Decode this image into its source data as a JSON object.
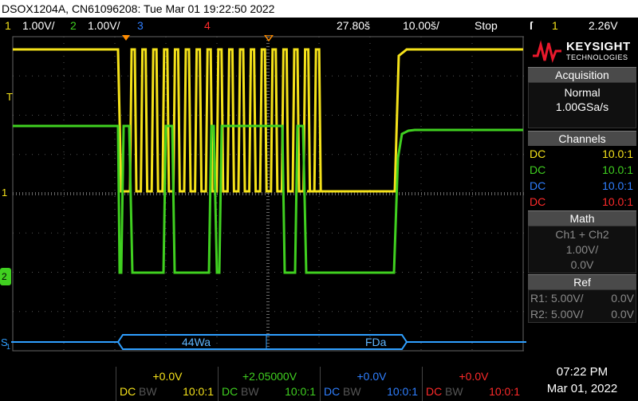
{
  "title_bar": "DSOX1204A, CN61096208: Tue Mar 01 19:22:50 2022",
  "status": {
    "ch1_num": "1",
    "ch1_scale": "1.00V/",
    "ch2_num": "2",
    "ch2_scale": "1.00V/",
    "ch3_num": "3",
    "ch4_num": "4",
    "time_pos": "27.80š",
    "time_scale": "10.00š/",
    "run_state": "Stop",
    "trig_icon": "ſ",
    "trig_ch": "1",
    "trig_level": "2.26V"
  },
  "logo": {
    "brand": "KEYSIGHT",
    "sub": "TECHNOLOGIES"
  },
  "acquisition": {
    "header": "Acquisition",
    "mode": "Normal",
    "rate": "1.00GSa/s"
  },
  "channels": {
    "header": "Channels",
    "rows": [
      {
        "coupling": "DC",
        "ratio": "10.0:1",
        "color": "#f5e21a"
      },
      {
        "coupling": "DC",
        "ratio": "10.0:1",
        "color": "#40d020"
      },
      {
        "coupling": "DC",
        "ratio": "10.0:1",
        "color": "#2f7fff"
      },
      {
        "coupling": "DC",
        "ratio": "10.0:1",
        "color": "#ff2a2a"
      }
    ]
  },
  "math": {
    "header": "Math",
    "function": "Ch1 + Ch2",
    "scale": "1.00V/",
    "offset": "0.0V"
  },
  "ref": {
    "header": "Ref",
    "r1_label": "R1:",
    "r1_scale": "5.00V/",
    "r1_offset": "0.0V",
    "r2_label": "R2:",
    "r2_scale": "5.00V/",
    "r2_offset": "0.0V"
  },
  "markers": {
    "t_marker": "T",
    "ch1_ground": "1",
    "ch2_ground": "2",
    "serial_label": "S",
    "serial_sub": "1"
  },
  "serial_decode": {
    "packet1": "44Wa",
    "packet2": "FDa"
  },
  "bottom_channels": [
    {
      "offset": "+0.0V",
      "coupling": "DC",
      "bw": "BW",
      "ratio": "10:0:1",
      "color": "#f5e21a"
    },
    {
      "offset": "+2.05000V",
      "coupling": "DC",
      "bw": "BW",
      "ratio": "10:0:1",
      "color": "#40d020"
    },
    {
      "offset": "+0.0V",
      "coupling": "DC",
      "bw": "BW",
      "ratio": "10:0:1",
      "color": "#2f7fff"
    },
    {
      "offset": "+0.0V",
      "coupling": "DC",
      "bw": "BW",
      "ratio": "10:0:1",
      "color": "#ff2a2a"
    }
  ],
  "clock": {
    "time": "07:22 PM",
    "date": "Mar 01, 2022"
  },
  "colors": {
    "ch1": "#f5e21a",
    "ch2": "#40d020",
    "ch3": "#2f7fff",
    "ch4": "#ff2a2a",
    "trigger": "#ff8c00"
  }
}
